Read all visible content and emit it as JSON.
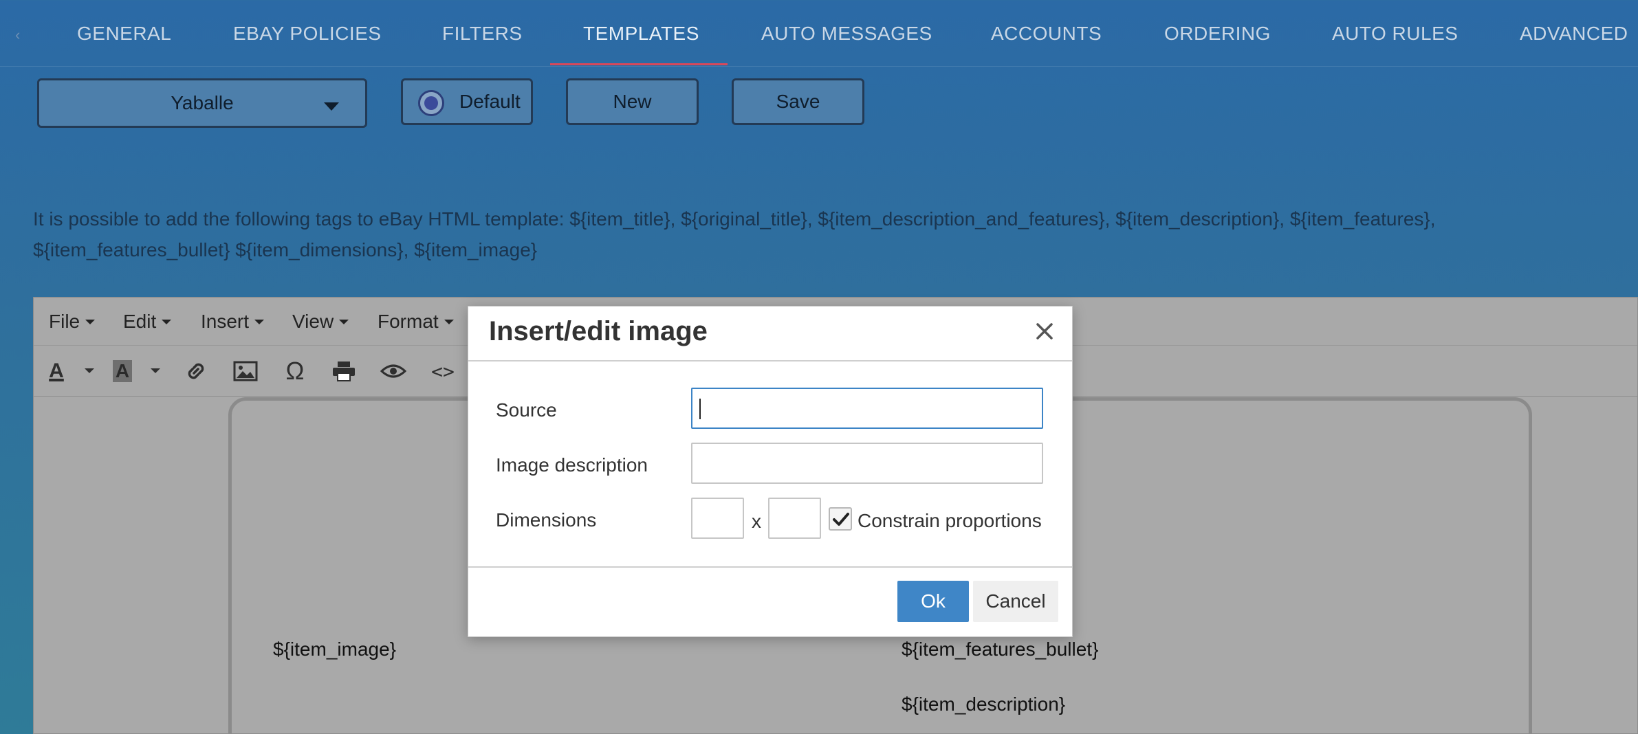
{
  "nav": {
    "tabs": [
      {
        "label": "GENERAL"
      },
      {
        "label": "EBAY POLICIES"
      },
      {
        "label": "FILTERS"
      },
      {
        "label": "TEMPLATES"
      },
      {
        "label": "AUTO MESSAGES"
      },
      {
        "label": "ACCOUNTS"
      },
      {
        "label": "ORDERING"
      },
      {
        "label": "AUTO RULES"
      },
      {
        "label": "ADVANCED"
      }
    ],
    "active_tab": "TEMPLATES",
    "active_color": "#d8485a"
  },
  "toolbar": {
    "template_select_value": "Yaballe",
    "default_label": "Default",
    "new_label": "New",
    "save_label": "Save"
  },
  "info": {
    "line1": "It is possible to add the following tags to eBay HTML template: ${item_title}, ${original_title}, ${item_description_and_features}, ${item_description}, ${item_features},",
    "line2": "${item_features_bullet} ${item_dimensions}, ${item_image}"
  },
  "editor": {
    "menu": [
      {
        "label": "File"
      },
      {
        "label": "Edit"
      },
      {
        "label": "Insert"
      },
      {
        "label": "View"
      },
      {
        "label": "Format"
      }
    ],
    "toolbar_icons": [
      "text-color-icon",
      "background-color-icon",
      "link-icon",
      "image-icon",
      "omega-icon",
      "print-icon",
      "preview-eye-icon",
      "code-icon"
    ],
    "text_color_glyph": "A",
    "background_color_glyph": "A",
    "omega_glyph": "Ω",
    "code_glyph": "<>",
    "content": {
      "item_image": "${item_image}",
      "item_features_bullet": "${item_features_bullet}",
      "item_description": "${item_description}"
    }
  },
  "dialog": {
    "title": "Insert/edit image",
    "source_label": "Source",
    "source_value": "",
    "description_label": "Image description",
    "description_value": "",
    "dimensions_label": "Dimensions",
    "width_value": "",
    "height_value": "",
    "x_separator": "x",
    "constrain_label": "Constrain proportions",
    "constrain_checked": true,
    "ok_label": "Ok",
    "cancel_label": "Cancel",
    "ok_color": "#3f86c7"
  }
}
